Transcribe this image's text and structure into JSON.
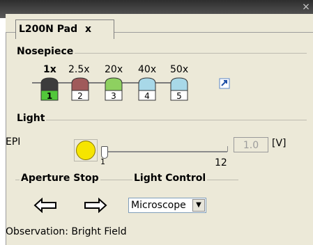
{
  "window": {
    "close_glyph": "×"
  },
  "tab": {
    "label": "L200N Pad",
    "close_glyph": "x"
  },
  "nosepiece": {
    "title": "Nosepiece",
    "objectives": [
      {
        "label": "1x",
        "number": "1",
        "selected": true,
        "cap_color": "#3c3c3c"
      },
      {
        "label": "2.5x",
        "number": "2",
        "selected": false,
        "cap_color": "#a05a5a"
      },
      {
        "label": "20x",
        "number": "3",
        "selected": false,
        "cap_color": "#8ed060"
      },
      {
        "label": "40x",
        "number": "4",
        "selected": false,
        "cap_color": "#a8d8e8"
      },
      {
        "label": "50x",
        "number": "5",
        "selected": false,
        "cap_color": "#a8d8e8"
      }
    ],
    "popout_icon": "popout-arrow-icon"
  },
  "light": {
    "title": "Light",
    "epi_label": "EPI",
    "slider_min_label": "1",
    "slider_max_label": "12",
    "slider_value": 1,
    "voltage_value": "1.0",
    "voltage_unit": "[V]"
  },
  "aperture": {
    "title": "Aperture Stop"
  },
  "light_control": {
    "title": "Light Control",
    "selected": "Microscope"
  },
  "status": {
    "observation": "Observation: Bright Field"
  }
}
